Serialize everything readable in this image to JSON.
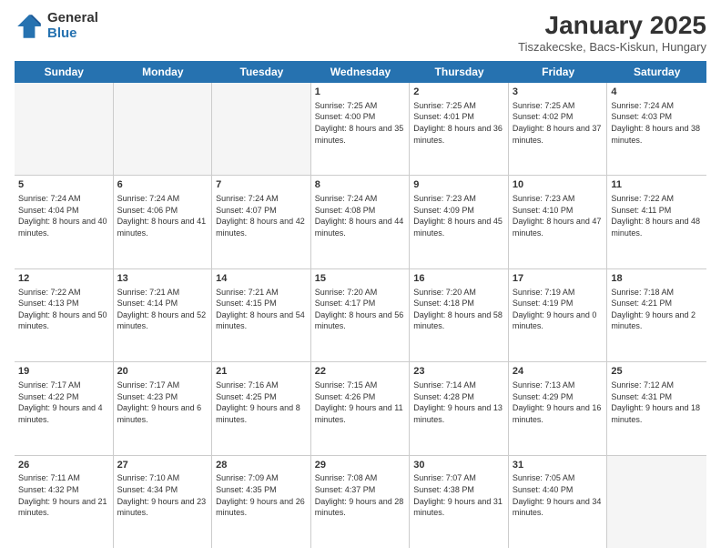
{
  "logo": {
    "general": "General",
    "blue": "Blue"
  },
  "header": {
    "month": "January 2025",
    "location": "Tiszakecske, Bacs-Kiskun, Hungary"
  },
  "days": [
    "Sunday",
    "Monday",
    "Tuesday",
    "Wednesday",
    "Thursday",
    "Friday",
    "Saturday"
  ],
  "weeks": [
    [
      {
        "day": "",
        "info": "",
        "empty": true
      },
      {
        "day": "",
        "info": "",
        "empty": true
      },
      {
        "day": "",
        "info": "",
        "empty": true
      },
      {
        "day": "1",
        "info": "Sunrise: 7:25 AM\nSunset: 4:00 PM\nDaylight: 8 hours and 35 minutes."
      },
      {
        "day": "2",
        "info": "Sunrise: 7:25 AM\nSunset: 4:01 PM\nDaylight: 8 hours and 36 minutes."
      },
      {
        "day": "3",
        "info": "Sunrise: 7:25 AM\nSunset: 4:02 PM\nDaylight: 8 hours and 37 minutes."
      },
      {
        "day": "4",
        "info": "Sunrise: 7:24 AM\nSunset: 4:03 PM\nDaylight: 8 hours and 38 minutes."
      }
    ],
    [
      {
        "day": "5",
        "info": "Sunrise: 7:24 AM\nSunset: 4:04 PM\nDaylight: 8 hours and 40 minutes."
      },
      {
        "day": "6",
        "info": "Sunrise: 7:24 AM\nSunset: 4:06 PM\nDaylight: 8 hours and 41 minutes."
      },
      {
        "day": "7",
        "info": "Sunrise: 7:24 AM\nSunset: 4:07 PM\nDaylight: 8 hours and 42 minutes."
      },
      {
        "day": "8",
        "info": "Sunrise: 7:24 AM\nSunset: 4:08 PM\nDaylight: 8 hours and 44 minutes."
      },
      {
        "day": "9",
        "info": "Sunrise: 7:23 AM\nSunset: 4:09 PM\nDaylight: 8 hours and 45 minutes."
      },
      {
        "day": "10",
        "info": "Sunrise: 7:23 AM\nSunset: 4:10 PM\nDaylight: 8 hours and 47 minutes."
      },
      {
        "day": "11",
        "info": "Sunrise: 7:22 AM\nSunset: 4:11 PM\nDaylight: 8 hours and 48 minutes."
      }
    ],
    [
      {
        "day": "12",
        "info": "Sunrise: 7:22 AM\nSunset: 4:13 PM\nDaylight: 8 hours and 50 minutes."
      },
      {
        "day": "13",
        "info": "Sunrise: 7:21 AM\nSunset: 4:14 PM\nDaylight: 8 hours and 52 minutes."
      },
      {
        "day": "14",
        "info": "Sunrise: 7:21 AM\nSunset: 4:15 PM\nDaylight: 8 hours and 54 minutes."
      },
      {
        "day": "15",
        "info": "Sunrise: 7:20 AM\nSunset: 4:17 PM\nDaylight: 8 hours and 56 minutes."
      },
      {
        "day": "16",
        "info": "Sunrise: 7:20 AM\nSunset: 4:18 PM\nDaylight: 8 hours and 58 minutes."
      },
      {
        "day": "17",
        "info": "Sunrise: 7:19 AM\nSunset: 4:19 PM\nDaylight: 9 hours and 0 minutes."
      },
      {
        "day": "18",
        "info": "Sunrise: 7:18 AM\nSunset: 4:21 PM\nDaylight: 9 hours and 2 minutes."
      }
    ],
    [
      {
        "day": "19",
        "info": "Sunrise: 7:17 AM\nSunset: 4:22 PM\nDaylight: 9 hours and 4 minutes."
      },
      {
        "day": "20",
        "info": "Sunrise: 7:17 AM\nSunset: 4:23 PM\nDaylight: 9 hours and 6 minutes."
      },
      {
        "day": "21",
        "info": "Sunrise: 7:16 AM\nSunset: 4:25 PM\nDaylight: 9 hours and 8 minutes."
      },
      {
        "day": "22",
        "info": "Sunrise: 7:15 AM\nSunset: 4:26 PM\nDaylight: 9 hours and 11 minutes."
      },
      {
        "day": "23",
        "info": "Sunrise: 7:14 AM\nSunset: 4:28 PM\nDaylight: 9 hours and 13 minutes."
      },
      {
        "day": "24",
        "info": "Sunrise: 7:13 AM\nSunset: 4:29 PM\nDaylight: 9 hours and 16 minutes."
      },
      {
        "day": "25",
        "info": "Sunrise: 7:12 AM\nSunset: 4:31 PM\nDaylight: 9 hours and 18 minutes."
      }
    ],
    [
      {
        "day": "26",
        "info": "Sunrise: 7:11 AM\nSunset: 4:32 PM\nDaylight: 9 hours and 21 minutes."
      },
      {
        "day": "27",
        "info": "Sunrise: 7:10 AM\nSunset: 4:34 PM\nDaylight: 9 hours and 23 minutes."
      },
      {
        "day": "28",
        "info": "Sunrise: 7:09 AM\nSunset: 4:35 PM\nDaylight: 9 hours and 26 minutes."
      },
      {
        "day": "29",
        "info": "Sunrise: 7:08 AM\nSunset: 4:37 PM\nDaylight: 9 hours and 28 minutes."
      },
      {
        "day": "30",
        "info": "Sunrise: 7:07 AM\nSunset: 4:38 PM\nDaylight: 9 hours and 31 minutes."
      },
      {
        "day": "31",
        "info": "Sunrise: 7:05 AM\nSunset: 4:40 PM\nDaylight: 9 hours and 34 minutes."
      },
      {
        "day": "",
        "info": "",
        "empty": true
      }
    ]
  ]
}
